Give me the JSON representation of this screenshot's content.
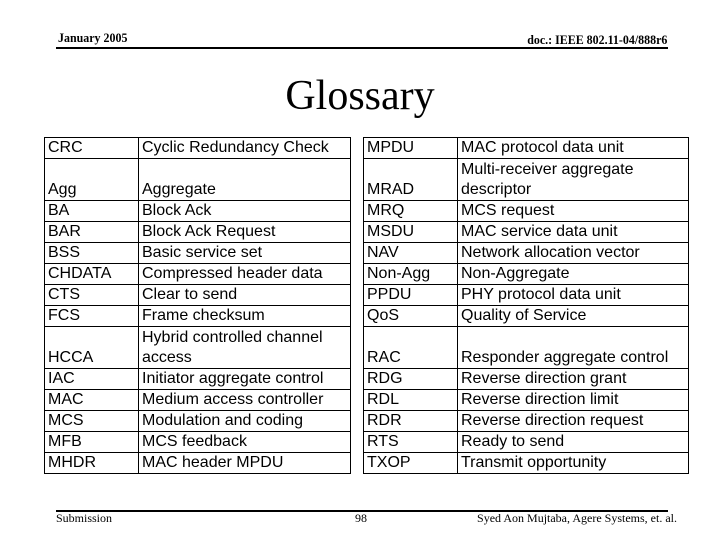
{
  "header": {
    "date": "January 2005",
    "doc_id": "doc.: IEEE 802.11-04/888r6"
  },
  "title": "Glossary",
  "glossary_left": [
    {
      "abbr": "CRC",
      "desc": "Cyclic Redundancy Check",
      "lines": 1
    },
    {
      "abbr": "Agg",
      "desc": "Aggregate",
      "lines": 2
    },
    {
      "abbr": "BA",
      "desc": "Block Ack",
      "lines": 1
    },
    {
      "abbr": "BAR",
      "desc": "Block Ack Request",
      "lines": 1
    },
    {
      "abbr": "BSS",
      "desc": "Basic service set",
      "lines": 1
    },
    {
      "abbr": "CHDATA",
      "desc": "Compressed header data",
      "lines": 1
    },
    {
      "abbr": "CTS",
      "desc": "Clear to send",
      "lines": 1
    },
    {
      "abbr": "FCS",
      "desc": "Frame checksum",
      "lines": 1
    },
    {
      "abbr": "HCCA",
      "desc": "Hybrid controlled channel access",
      "lines": 2
    },
    {
      "abbr": "IAC",
      "desc": "Initiator aggregate control",
      "lines": 1
    },
    {
      "abbr": "MAC",
      "desc": "Medium access controller",
      "lines": 1
    },
    {
      "abbr": "MCS",
      "desc": "Modulation and coding",
      "lines": 1
    },
    {
      "abbr": "MFB",
      "desc": "MCS feedback",
      "lines": 1
    },
    {
      "abbr": "MHDR",
      "desc": "MAC header MPDU",
      "lines": 1
    }
  ],
  "glossary_right": [
    {
      "abbr": "MPDU",
      "desc": "MAC protocol data unit",
      "lines": 1
    },
    {
      "abbr": "MRAD",
      "desc": "Multi-receiver aggregate descriptor",
      "lines": 2
    },
    {
      "abbr": "MRQ",
      "desc": "MCS request",
      "lines": 1
    },
    {
      "abbr": "MSDU",
      "desc": "MAC service data unit",
      "lines": 1
    },
    {
      "abbr": "NAV",
      "desc": "Network allocation vector",
      "lines": 1
    },
    {
      "abbr": "Non-Agg",
      "desc": "Non-Aggregate",
      "lines": 1
    },
    {
      "abbr": "PPDU",
      "desc": "PHY protocol data unit",
      "lines": 1
    },
    {
      "abbr": "QoS",
      "desc": "Quality of Service",
      "lines": 1
    },
    {
      "abbr": "RAC",
      "desc": "Responder aggregate control",
      "lines": 2
    },
    {
      "abbr": "RDG",
      "desc": "Reverse direction grant",
      "lines": 1
    },
    {
      "abbr": "RDL",
      "desc": "Reverse direction limit",
      "lines": 1
    },
    {
      "abbr": "RDR",
      "desc": "Reverse direction request",
      "lines": 1
    },
    {
      "abbr": "RTS",
      "desc": "Ready to send",
      "lines": 1
    },
    {
      "abbr": "TXOP",
      "desc": "Transmit opportunity",
      "lines": 1
    }
  ],
  "footer": {
    "label": "Submission",
    "page_number": "98",
    "author": "Syed Aon Mujtaba, Agere Systems, et. al."
  }
}
